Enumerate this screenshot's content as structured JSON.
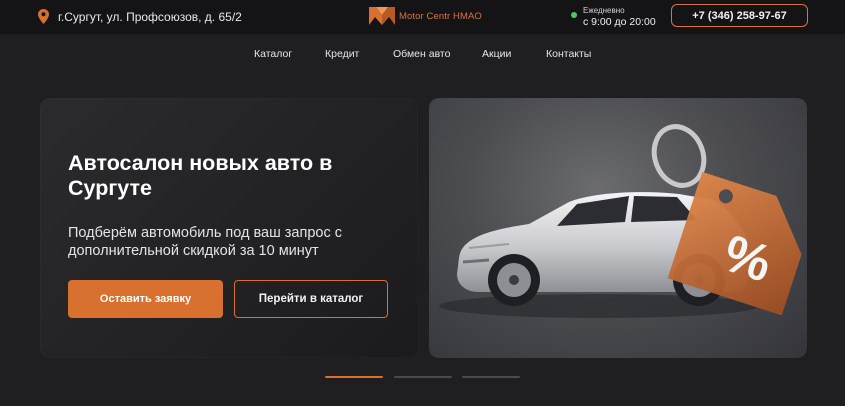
{
  "topbar": {
    "address": "г.Сургут, ул. Профсоюзов, д. 65/2",
    "address_icon": "map-pin-icon",
    "logo_text": "Motor Centr HMAO",
    "hours_label": "Ежедневно",
    "hours_time": "с 9:00 до 20:00",
    "phone": "+7 (346) 258-97-67"
  },
  "nav": {
    "items": [
      {
        "label": "Каталог"
      },
      {
        "label": "Кредит"
      },
      {
        "label": "Обмен авто"
      },
      {
        "label": "Акции"
      },
      {
        "label": "Контакты"
      }
    ]
  },
  "hero": {
    "title": "Автосалон новых авто в Сургуте",
    "subtitle": "Подберём автомобиль под ваш запрос с дополнительной скидкой за 10 минут",
    "primary_button": "Оставить заявку",
    "secondary_button": "Перейти в каталог",
    "image_icon": "car-with-discount-tag-icon",
    "tag_text": "%"
  },
  "slider": {
    "count": 3,
    "active_index": 0
  },
  "colors": {
    "accent": "#d8702f",
    "background": "#1f1f21",
    "topbar": "#141416",
    "online_dot": "#4ccb5d"
  }
}
